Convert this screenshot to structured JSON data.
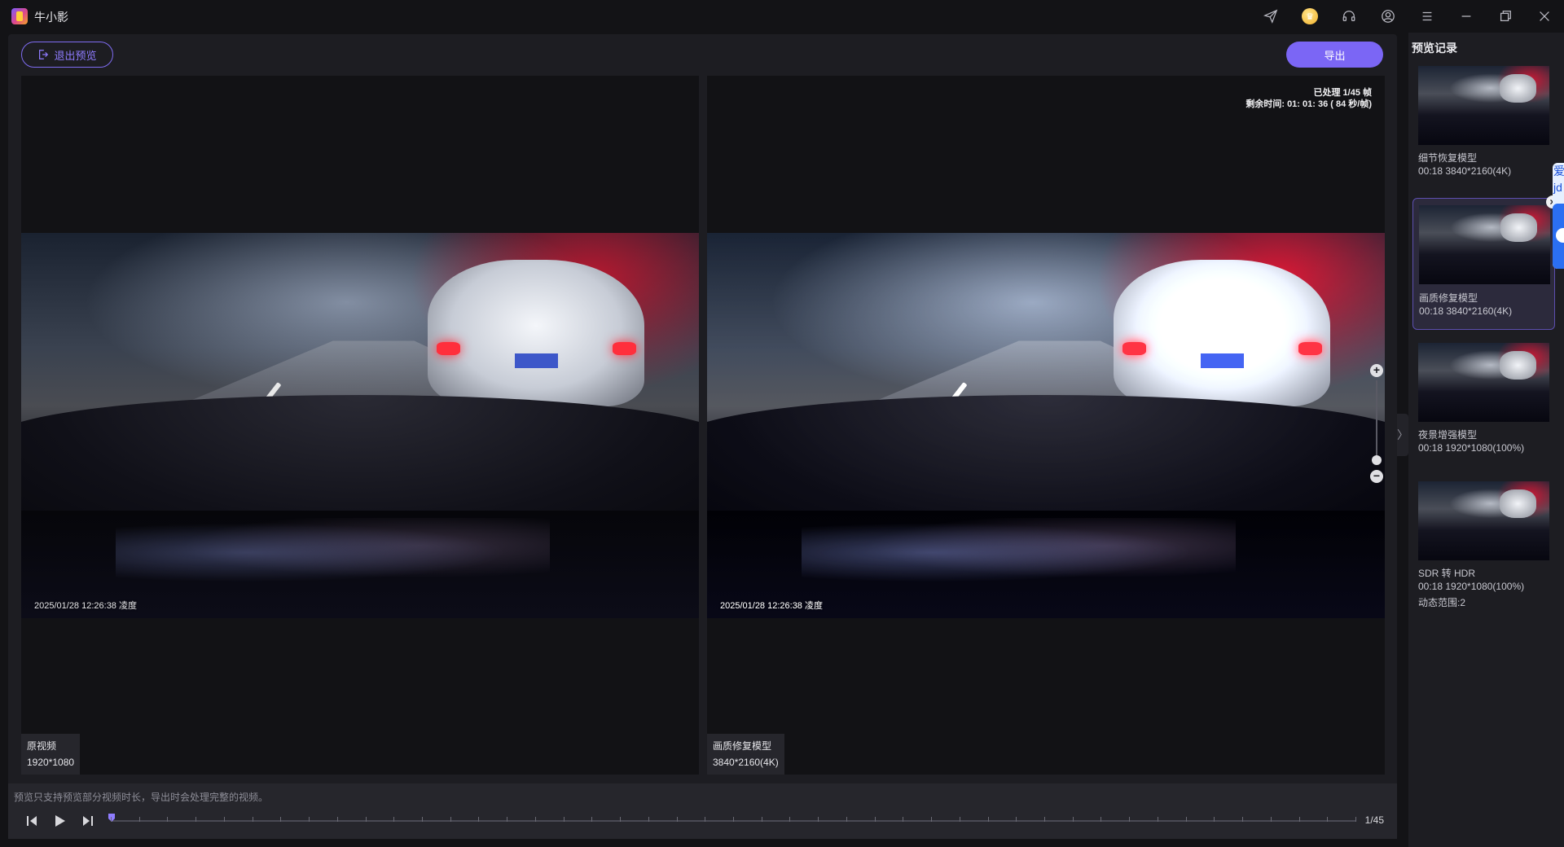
{
  "app": {
    "title": "牛小影"
  },
  "toolbar": {
    "exit_preview": "退出预览",
    "export": "导出"
  },
  "left_pane": {
    "label": "原视频",
    "resolution": "1920*1080",
    "timestamp": "2025/01/28 12:26:38  凌度"
  },
  "right_pane": {
    "label": "画质修复模型",
    "resolution": "3840*2160(4K)",
    "timestamp": "2025/01/28 12:26:38  凌度",
    "processed": "已处理 1/45 帧",
    "remaining": "剩余时间: 01: 01: 36 ( 84 秒/帧)"
  },
  "bottom": {
    "hint": "预览只支持预览部分视频时长，导出时会处理完整的视频。",
    "frame_counter": "1/45",
    "progress": 0.0
  },
  "sidebar": {
    "title": "预览记录",
    "records": [
      {
        "name": "细节恢复模型",
        "meta": "00:18   3840*2160(4K)",
        "extra": ""
      },
      {
        "name": "画质修复模型",
        "meta": "00:18   3840*2160(4K)",
        "extra": ""
      },
      {
        "name": "夜景增强模型",
        "meta": "00:18   1920*1080(100%)",
        "extra": ""
      },
      {
        "name": "SDR 转 HDR",
        "meta": "00:18   1920*1080(100%)",
        "extra": "动态范围:2"
      }
    ]
  },
  "float_widget": {
    "text": "爱jd"
  },
  "colors": {
    "accent": "#7b66f5",
    "panel": "#1d1d22",
    "background": "#131316"
  }
}
